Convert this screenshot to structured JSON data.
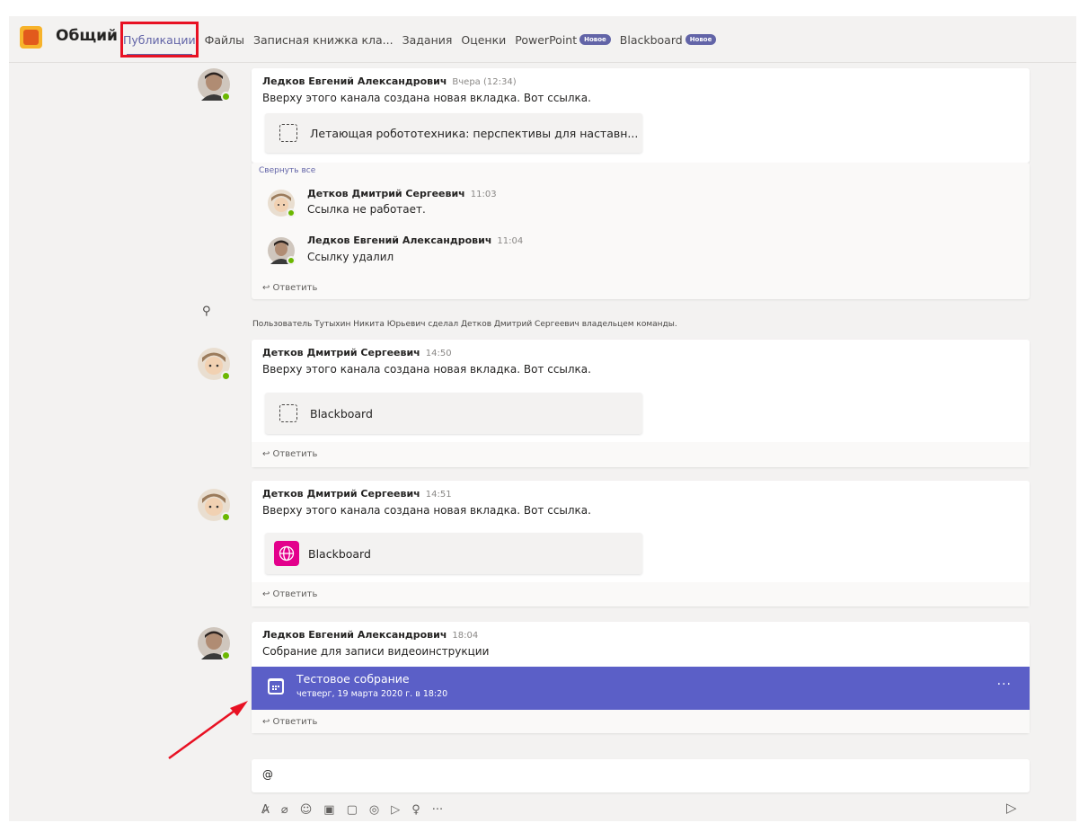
{
  "header": {
    "channel": "Общий",
    "tabs": [
      {
        "label": "Публикации",
        "active": true
      },
      {
        "label": "Файлы"
      },
      {
        "label": "Записная книжка кла..."
      },
      {
        "label": "Задания"
      },
      {
        "label": "Оценки"
      },
      {
        "label": "PowerPoint",
        "badge": "Новое"
      },
      {
        "label": "Blackboard",
        "badge": "Новое"
      }
    ]
  },
  "posts": [
    {
      "author": "Ледков Евгений Александрович",
      "time": "Вчера (12:34)",
      "text": "Вверху этого канала создана новая вкладка. Вот ссылка.",
      "link": "Летающая робототехника: перспективы для наставн...",
      "collapse": "Свернуть все",
      "replies": [
        {
          "author": "Детков Дмитрий Сергеевич",
          "time": "11:03",
          "text": "Ссылка не работает."
        },
        {
          "author": "Ледков Евгений Александрович",
          "time": "11:04",
          "text": "Ссылку удалил"
        }
      ],
      "reply_label": "↩ Ответить"
    },
    {
      "author": "Детков Дмитрий Сергеевич",
      "time": "14:50",
      "text": "Вверху этого канала создана новая вкладка. Вот ссылка.",
      "link": "Blackboard",
      "reply_label": "↩ Ответить"
    },
    {
      "author": "Детков Дмитрий Сергеевич",
      "time": "14:51",
      "text": "Вверху этого канала создана новая вкладка. Вот ссылка.",
      "link": "Blackboard",
      "reply_label": "↩ Ответить"
    },
    {
      "author": "Ледков Евгений Александрович",
      "time": "18:04",
      "text": "Собрание для записи видеоинструкции",
      "meeting": {
        "title": "Тестовое собрание",
        "date": "четверг, 19 марта 2020 г. в 18:20",
        "more": "···"
      },
      "reply_label": "↩ Ответить"
    }
  ],
  "system_message": "Пользователь Тутыхин Никита Юрьевич сделал Детков Дмитрий Сергеевич владельцем команды.",
  "compose": {
    "text": "@"
  },
  "toolbar": {
    "more": "···",
    "send": "▷"
  },
  "icons": {
    "team": "team-icon",
    "bulb": "lightbulb-icon",
    "format": "format-icon",
    "attach": "paperclip-icon",
    "emoji": "emoji-icon",
    "gif": "gif-icon",
    "sticker": "sticker-icon",
    "meet": "meet-now-icon",
    "stream": "stream-icon",
    "praise": "praise-icon",
    "send": "send-icon"
  },
  "colors": {
    "accent": "#6264a7",
    "highlight": "#e81123",
    "meeting": "#5b5fc7",
    "globe": "#e3008c"
  }
}
